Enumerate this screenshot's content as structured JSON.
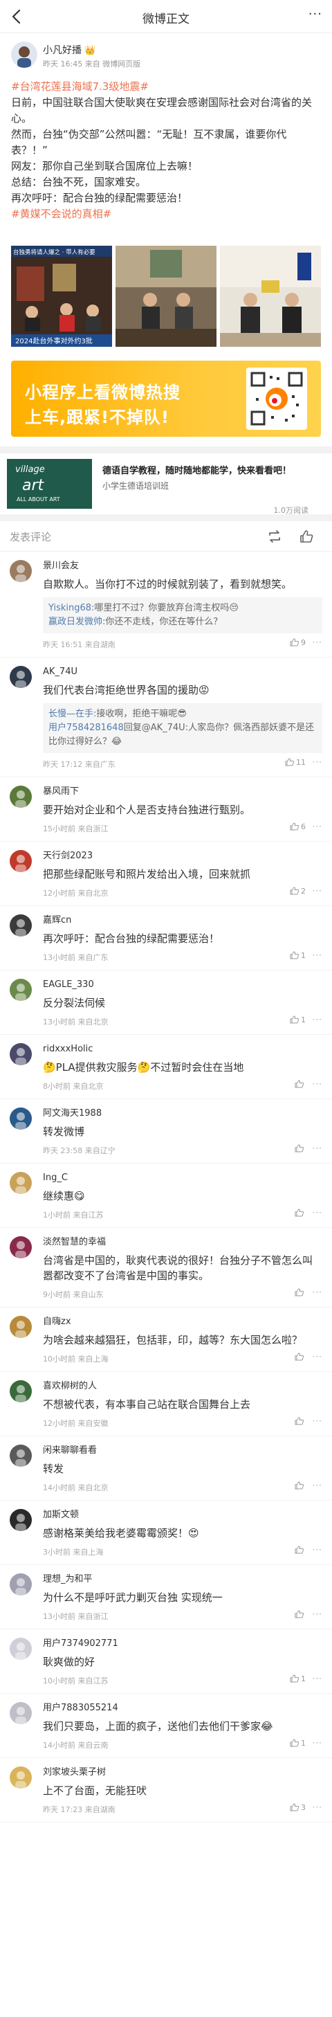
{
  "topbar": {
    "title": "微博正文",
    "more": "···"
  },
  "post": {
    "author": "小凡好播",
    "crown": "👑",
    "meta": "昨天 16:45 来自 微博网页版",
    "tag1": "#台湾花莲县海域7.3级地震#",
    "line1": "日前，中国驻联合国大使耿爽在安理会感谢国际社会对台湾省的关心。",
    "line2": "然而，台独“伪交部”公然叫嚣：“无耻！互不隶属，谁要你代表？！”",
    "line3": "网友：那你自己坐到联合国席位上去嘛！",
    "line4": "总结：台独不死，国家难安。",
    "line5": "再次呼吁：配合台独的绿配需要惩治！",
    "tag2": "#黄媒不会说的真相#",
    "photo1_caption_top": "台独勇将请人爆之 · 带人有必要",
    "photo1_caption_bottom": "2024赴台外事对外约3批"
  },
  "banner": {
    "line1": "小程序上看微博热搜",
    "line2": "上车,跟紧!不掉队!"
  },
  "ad": {
    "thumb_line1": "village",
    "thumb_line2": "art",
    "thumb_line3": "ALL ABOUT ART",
    "title": "德语自学教程，随时随地都能学，快来看看吧！",
    "sub": "小学生德语培训班",
    "views": "1.0万阅读"
  },
  "comment_bar": {
    "label": "发表评论"
  },
  "comments": [
    {
      "name": "景川会友",
      "text": "自欺欺人。当你打不过的时候就别装了，看到就想笑。",
      "replies": [
        {
          "user": "Yisking68:",
          "text": "哪里打不过？你要放弃台湾主权吗😒"
        },
        {
          "user": "赢政日发微帅:",
          "text": "你还不走线，你还在等什么？"
        }
      ],
      "time": "昨天 16:51 来自湖南",
      "likes": "9"
    },
    {
      "name": "AK_74U",
      "text": "我们代表台湾拒绝世界各国的援助😡",
      "replies": [
        {
          "user": "长慢—在手:",
          "text": "接收啊，拒绝干嘛呢😎"
        },
        {
          "user": "用户7584281648",
          "text": "回复@AK_74U:人家岛你？佩洛西部妖婆不是还比你过得好么？😂"
        }
      ],
      "time": "昨天 17:12 来自广东",
      "likes": "11"
    },
    {
      "name": "暴风雨下",
      "text": "要开始对企业和个人是否支持台独进行甄别。",
      "replies": [],
      "time": "15小时前 来自浙江",
      "likes": "6"
    },
    {
      "name": "天行剑2023",
      "text": "把那些绿配账号和照片发给出入境，回来就抓",
      "replies": [],
      "time": "12小时前 来自北京",
      "likes": "2"
    },
    {
      "name": "嘉辉cn",
      "text": "再次呼吁：配合台独的绿配需要惩治！",
      "replies": [],
      "time": "13小时前 来自广东",
      "likes": "1"
    },
    {
      "name": "EAGLE_330",
      "text": "反分裂法伺候",
      "replies": [],
      "time": "13小时前 来自北京",
      "likes": "1"
    },
    {
      "name": "ridxxxHolic",
      "text": "🤔PLA提供救灾服务🤔不过暂时会住在当地",
      "replies": [],
      "time": "8小时前 来自北京",
      "likes": ""
    },
    {
      "name": "阿文海天1988",
      "text": "转发微博",
      "replies": [],
      "time": "昨天 23:58 来自辽宁",
      "likes": ""
    },
    {
      "name": "Ing_C",
      "text": "继续惠😋",
      "replies": [],
      "time": "1小时前 来自江苏",
      "likes": ""
    },
    {
      "name": "淡然智慧的幸福",
      "text": "台湾省是中国的，耿爽代表说的很好！台独分子不管怎么叫嚣都改变不了台湾省是中国的事实。",
      "replies": [],
      "time": "9小时前 来自山东",
      "likes": ""
    },
    {
      "name": "自嗨zx",
      "text": "为啥会越来越猖狂，包括菲，印，越等？东大国怎么啦？",
      "replies": [],
      "time": "10小时前 来自上海",
      "likes": ""
    },
    {
      "name": "喜欢柳树的人",
      "text": "不想被代表，有本事自己站在联合国舞台上去",
      "replies": [],
      "time": "12小时前 来自安徽",
      "likes": ""
    },
    {
      "name": "闲来聊聊看看",
      "text": "转发",
      "replies": [],
      "time": "14小时前 来自北京",
      "likes": ""
    },
    {
      "name": "加斯文顿",
      "text": "感谢格莱美给我老婆霉霉颁奖！😍",
      "replies": [],
      "time": "3小时前 来自上海",
      "likes": ""
    },
    {
      "name": "理想_为和平",
      "text": "为什么不是呼吁武力剿灭台独 实现统一",
      "replies": [],
      "time": "13小时前 来自浙江",
      "likes": ""
    },
    {
      "name": "用户7374902771",
      "text": "耿爽做的好",
      "replies": [],
      "time": "10小时前 来自江苏",
      "likes": "1"
    },
    {
      "name": "用户7883055214",
      "text": "我们只要岛，上面的疯子，送他们去他们干爹家😂",
      "replies": [],
      "time": "14小时前 来自云南",
      "likes": "1"
    },
    {
      "name": "刘家坡头栗子树",
      "text": "上不了台面，无能狂吠",
      "replies": [],
      "time": "昨天 17:23 来自湖南",
      "likes": "3"
    }
  ]
}
